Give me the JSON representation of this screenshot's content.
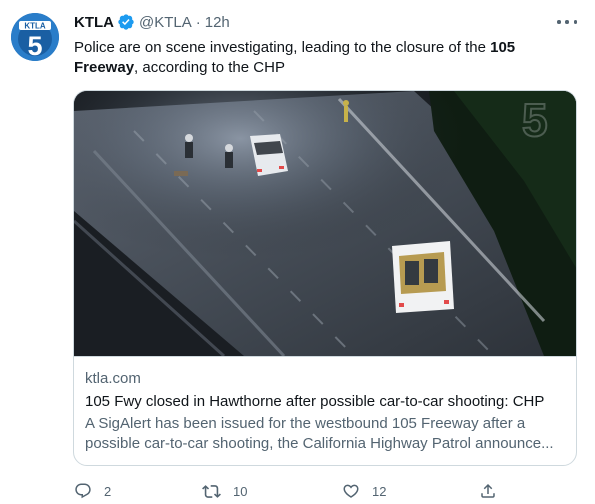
{
  "tweet": {
    "author_name": "KTLA",
    "handle": "@KTLA",
    "separator": "·",
    "time": "12h",
    "text_part1": "Police are on scene investigating, leading to the closure of the ",
    "text_bold1": "105 Freeway",
    "text_part2": ", according to the CHP"
  },
  "avatar": {
    "logo_text": "KTLA",
    "logo_number": "5"
  },
  "card": {
    "domain": "ktla.com",
    "title": "105 Fwy closed in Hawthorne after possible car-to-car shooting: CHP",
    "description": "A SigAlert has been issued for the westbound 105 Freeway after a possible car-to-car shooting, the California Highway Patrol announce..."
  },
  "actions": {
    "replies": "2",
    "retweets": "10",
    "likes": "12"
  },
  "colors": {
    "accent": "#1d9bf0",
    "secondary_text": "#536471",
    "border": "#cfd9de",
    "brand": "#1d6fb8"
  },
  "icons": {
    "verified": "verified-badge-icon",
    "more": "more-options-icon",
    "reply": "reply-icon",
    "retweet": "retweet-icon",
    "like": "heart-icon",
    "share": "share-icon"
  }
}
